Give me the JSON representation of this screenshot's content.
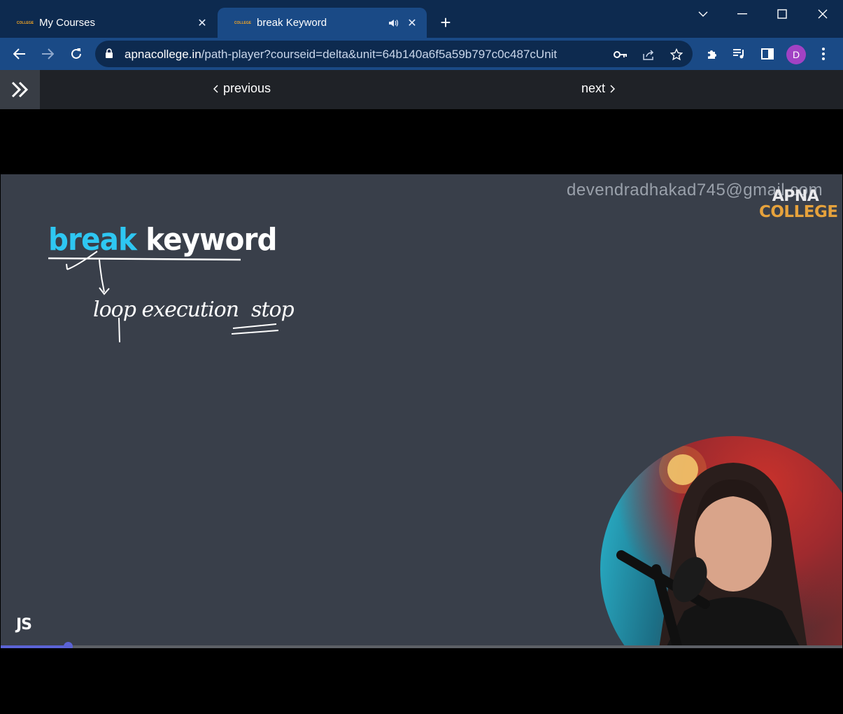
{
  "tabs": [
    {
      "title": "My Courses",
      "favicon": "COLLEGE"
    },
    {
      "title": "break Keyword",
      "favicon": "COLLEGE"
    }
  ],
  "address": {
    "host": "apnacollege.in",
    "path": "/path-player?courseid=delta&unit=64b140a6f5a59b797c0c487cUnit"
  },
  "profile": {
    "initial": "D",
    "color": "#a142c4"
  },
  "course_nav": {
    "previous": "previous",
    "next": "next"
  },
  "video": {
    "watermark": "devendradhakad745@gmail.com",
    "logo_line1": "APNA",
    "logo_line2": "COLLEGE",
    "slide_title_keyword": "break",
    "slide_title_rest": "keyword",
    "handwriting_main": "loop execution",
    "handwriting_emphasis": "stop",
    "corner_badge": "JS",
    "progress_fraction": 0.08
  },
  "colors": {
    "tab_strip": "#0d2a4f",
    "toolbar": "#1a4a86",
    "slide_bg": "#393f4a",
    "keyword": "#2ec7f2",
    "progress": "#5b63d6",
    "logo_accent": "#e6a23c"
  },
  "icons": [
    "back-icon",
    "forward-icon",
    "reload-icon",
    "lock-icon",
    "key-icon",
    "share-icon",
    "star-icon",
    "extensions-icon",
    "media-icon",
    "side-panel-icon",
    "menu-icon",
    "expand-sidebar-icon",
    "speaker-icon",
    "close-icon"
  ]
}
